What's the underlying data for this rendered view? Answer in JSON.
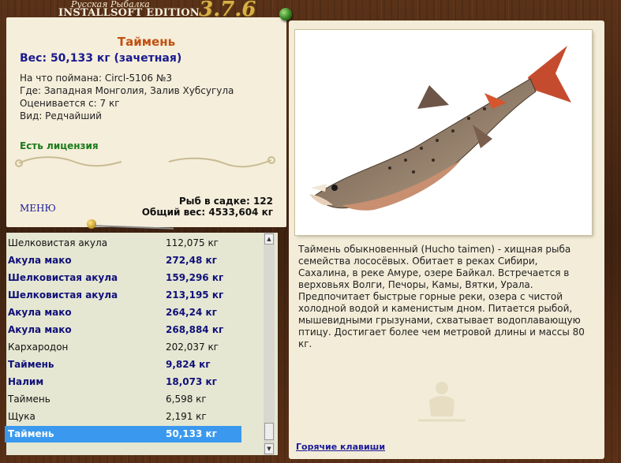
{
  "brand": {
    "line1": "Русская Рыбалка",
    "line2": "INSTALLSOFT EDITION",
    "version": "3.7.6"
  },
  "fish": {
    "name": "Таймень",
    "weight": "Вес: 50,133 кг (зачетная)",
    "caught_with": "На что поймана: Circl-5106 №3",
    "location": "Где: Западная Монголия, Залив Хубсугула",
    "valued_from": "Оценивается с: 7 кг",
    "rarity": "Вид: Редчайший",
    "license": "Есть лицензия"
  },
  "menu": {
    "label": "МЕНЮ"
  },
  "cage": {
    "count": "Рыб в садке: 122",
    "total": "Общий вес: 4533,604 кг"
  },
  "catch_list": [
    {
      "name": "Шелковистая акула",
      "weight": "112,075 кг",
      "bold": false,
      "selected": false
    },
    {
      "name": "Акула мако",
      "weight": "272,48 кг",
      "bold": true,
      "selected": false
    },
    {
      "name": "Шелковистая акула",
      "weight": "159,296 кг",
      "bold": true,
      "selected": false
    },
    {
      "name": "Шелковистая акула",
      "weight": "213,195 кг",
      "bold": true,
      "selected": false
    },
    {
      "name": "Акула мако",
      "weight": "264,24 кг",
      "bold": true,
      "selected": false
    },
    {
      "name": "Акула мако",
      "weight": "268,884 кг",
      "bold": true,
      "selected": false
    },
    {
      "name": "Кархародон",
      "weight": "202,037 кг",
      "bold": false,
      "selected": false
    },
    {
      "name": "Таймень",
      "weight": "9,824 кг",
      "bold": true,
      "selected": false
    },
    {
      "name": "Налим",
      "weight": "18,073 кг",
      "bold": true,
      "selected": false
    },
    {
      "name": "Таймень",
      "weight": "6,598 кг",
      "bold": false,
      "selected": false
    },
    {
      "name": "Щука",
      "weight": "2,191 кг",
      "bold": false,
      "selected": false
    },
    {
      "name": "Таймень",
      "weight": "50,133 кг",
      "bold": true,
      "selected": true
    }
  ],
  "description": "Таймень обыкновенный (Hucho taimen) - хищная рыба семейства лососёвых. Обитает в реках Сибири, Сахалина, в реке Амуре, озере Байкал. Встречается в верховьях Волги, Печоры, Камы, Вятки, Урала. Предпочитает быстрые горные реки, озера с чистой холодной водой и каменистым дном. Питается рыбой, мышевидными грызунами, схватывает водоплавающую птицу. Достигает более чем метровой длины и массы 80 кг.",
  "hotkeys": {
    "label": "Горячие клавиши"
  },
  "colors": {
    "selected_row": "#3a99ee",
    "fish_name": "#c25010",
    "weight_text": "#1a1a8e",
    "license_text": "#1b7a1b"
  }
}
